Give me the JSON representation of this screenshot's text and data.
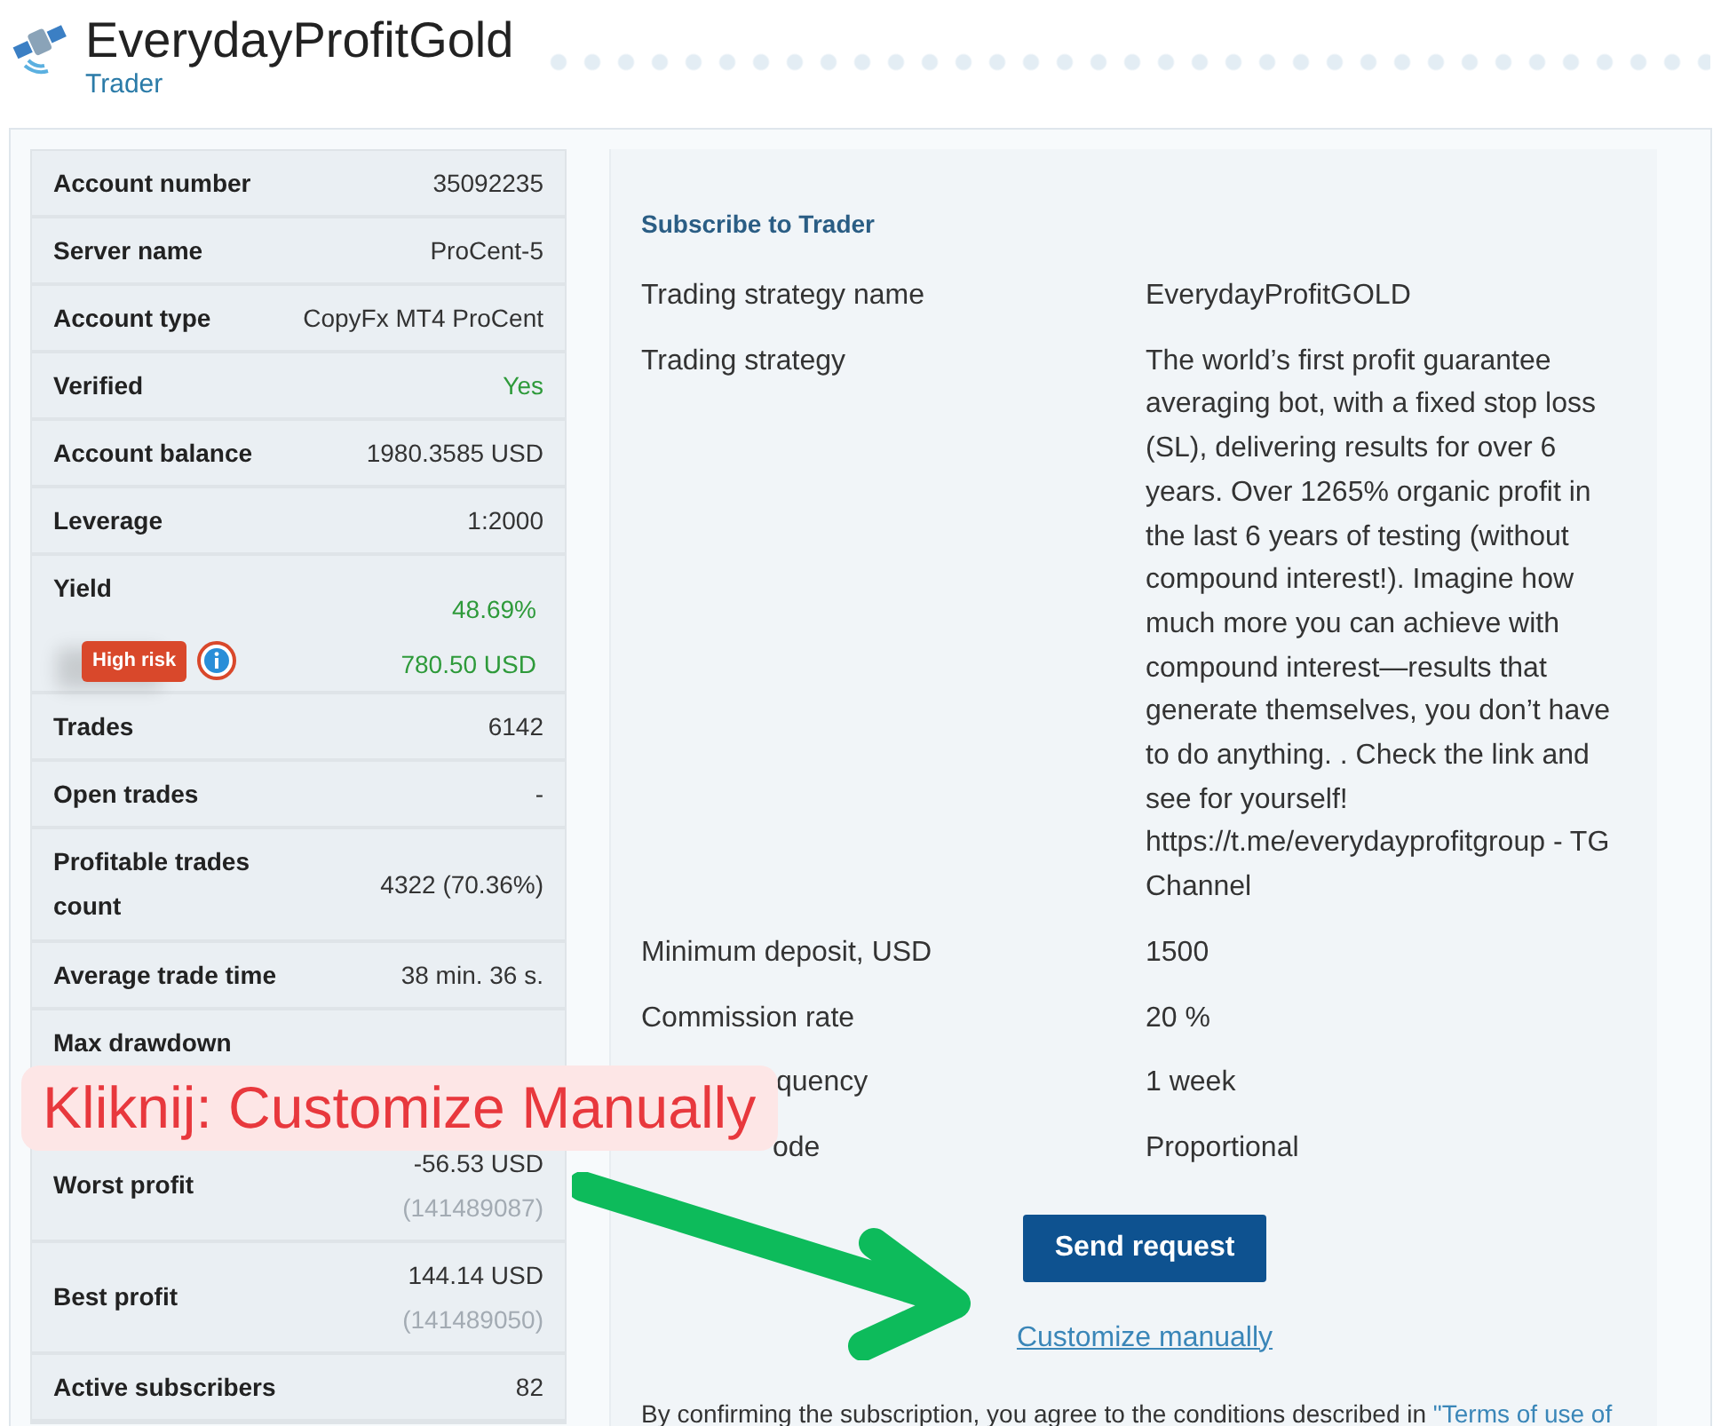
{
  "header": {
    "title": "EverydayProfitGold",
    "subtitle": "Trader"
  },
  "stats": [
    {
      "kind": "plain",
      "label": "Account number",
      "value": "35092235"
    },
    {
      "kind": "plain",
      "label": "Server name",
      "value": "ProCent-5"
    },
    {
      "kind": "plain",
      "label": "Account type",
      "value": "CopyFx MT4 ProCent"
    },
    {
      "kind": "positive",
      "label": "Verified",
      "value": "Yes"
    },
    {
      "kind": "plain",
      "label": "Account balance",
      "value": "1980.3585 USD"
    },
    {
      "kind": "plain",
      "label": "Leverage",
      "value": "1:2000"
    },
    {
      "kind": "yield",
      "label": "Yield",
      "value": "48.69%",
      "value_2": "780.50 USD",
      "badge": "High risk"
    },
    {
      "kind": "plain",
      "label": "Trades",
      "value": "6142"
    },
    {
      "kind": "plain",
      "label": "Open trades",
      "value": "-"
    },
    {
      "kind": "plain",
      "label": "Profitable trades count",
      "value": "4322 (70.36%)"
    },
    {
      "kind": "plain",
      "label": "Average trade time",
      "value": "38 min. 36 s."
    },
    {
      "kind": "hidden",
      "label": "Max drawdown"
    },
    {
      "kind": "ticket",
      "label": "Worst profit",
      "value": "-56.53 USD",
      "value_2": "(141489087)"
    },
    {
      "kind": "ticket",
      "label": "Best profit",
      "value": "144.14 USD",
      "value_2": "(141489050)"
    },
    {
      "kind": "plain",
      "label": "Active subscribers",
      "value": "82"
    }
  ],
  "subscribe": {
    "title": "Subscribe to Trader",
    "fields": [
      {
        "kind": "full",
        "label": "Trading strategy name",
        "value": "EverydayProfitGOLD"
      },
      {
        "kind": "full",
        "label": "Trading strategy",
        "value": "The world’s first profit guarantee averaging bot, with a fixed stop loss (SL), delivering results for over 6 years. Over 1265% organic profit in the last 6 years of testing (without compound interest!). Imagine how much more you can achieve with compound interest—results that generate themselves, you don’t have to do anything. . Check the link and see for yourself! https://t.me/everydayprofitgroup - TG Channel"
      },
      {
        "kind": "full",
        "label": "Minimum deposit, USD",
        "value": "1500"
      },
      {
        "kind": "full",
        "label": "Commission rate",
        "value": "20 %"
      },
      {
        "kind": "cut",
        "label": "quency",
        "value": "1 week"
      },
      {
        "kind": "cut",
        "label": "ode",
        "value": "Proportional"
      }
    ],
    "button": "Send request",
    "link": "Customize manually",
    "terms": "By confirming the subscription, you agree to the conditions described in ",
    "terms_link": "\"Terms of use of"
  },
  "overlay": {
    "text": "Kliknij: Customize Manually"
  }
}
